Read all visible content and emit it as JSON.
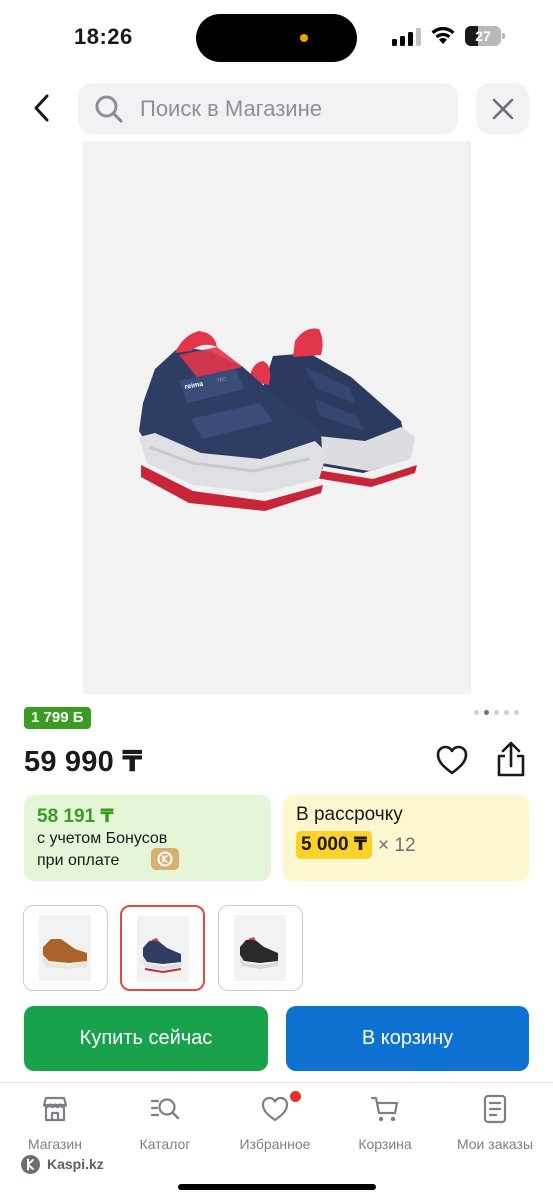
{
  "status_bar": {
    "time": "18:26",
    "battery": "27"
  },
  "search": {
    "placeholder": "Поиск в Магазине",
    "value": ""
  },
  "product": {
    "image_alt": "Детские ботинки Reima",
    "shoe_brand_label": "reima",
    "shoe_tec_label": "TEC",
    "bonus_points": "1 799 Б",
    "gallery": {
      "count": 5,
      "active_index": 1
    },
    "price": "59 990 ₸",
    "bonus_card": {
      "amount": "58 191 ₸",
      "line1": "с учетом Бонусов",
      "line2": "при оплате"
    },
    "installment_card": {
      "title": "В рассрочку",
      "monthly": "5 000 ₸",
      "term": "× 12"
    },
    "variants": [
      {
        "color": "brown",
        "selected": false
      },
      {
        "color": "navy",
        "selected": true
      },
      {
        "color": "black",
        "selected": false
      }
    ]
  },
  "actions": {
    "buy_now": "Купить сейчас",
    "add_to_cart": "В корзину"
  },
  "tabbar": {
    "items": [
      {
        "label": "Магазин",
        "icon": "store-icon"
      },
      {
        "label": "Каталог",
        "icon": "catalog-icon"
      },
      {
        "label": "Избранное",
        "icon": "heart-icon",
        "has_notification": true
      },
      {
        "label": "Корзина",
        "icon": "cart-icon"
      },
      {
        "label": "Мои заказы",
        "icon": "orders-icon"
      }
    ]
  },
  "watermark": "Kaspi.kz",
  "colors": {
    "bonus_green": "#3b9b22",
    "buy_green": "#1aa14c",
    "cart_blue": "#0d72d1",
    "installment_yellow": "#fcd12a",
    "selected_border": "#e24a3b"
  }
}
